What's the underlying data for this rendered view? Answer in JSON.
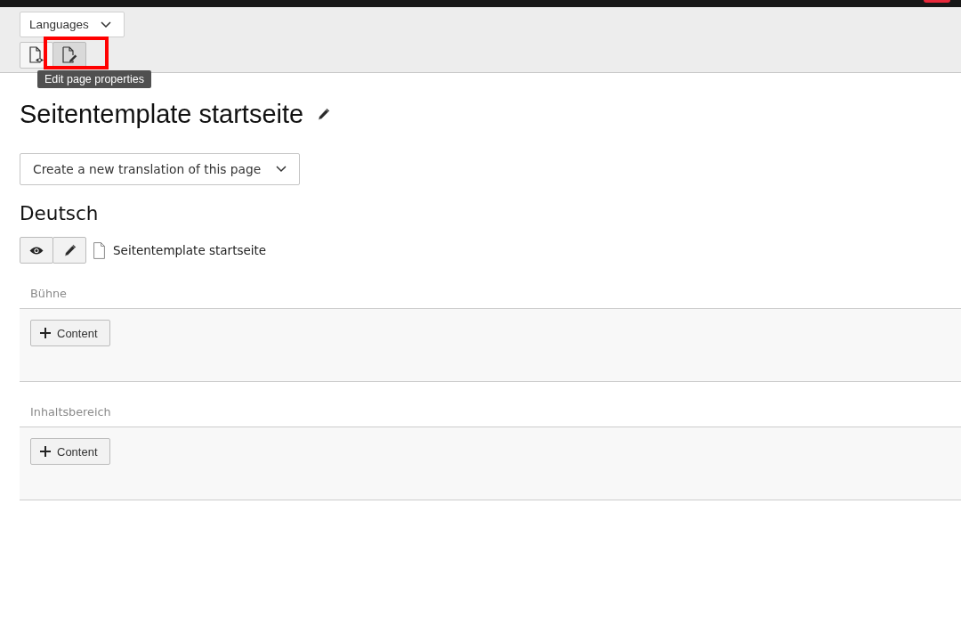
{
  "toolbar": {
    "language_menu": {
      "label": "Languages"
    },
    "buttons": [
      {
        "kind": "view_page",
        "hovered": false,
        "highlighted": false
      },
      {
        "kind": "edit_page",
        "hovered": true,
        "highlighted": true,
        "tooltip": "Edit page properties"
      }
    ]
  },
  "page": {
    "title": "Seitentemplate startseite"
  },
  "translation_menu": {
    "label": "Create a new translation of this page"
  },
  "language_section": {
    "heading": "Deutsch",
    "page_link": "Seitentemplate startseite",
    "sections": [
      {
        "title": "Bühne",
        "button": "Content"
      },
      {
        "title": "Inhaltsbereich",
        "button": "Content"
      }
    ]
  }
}
